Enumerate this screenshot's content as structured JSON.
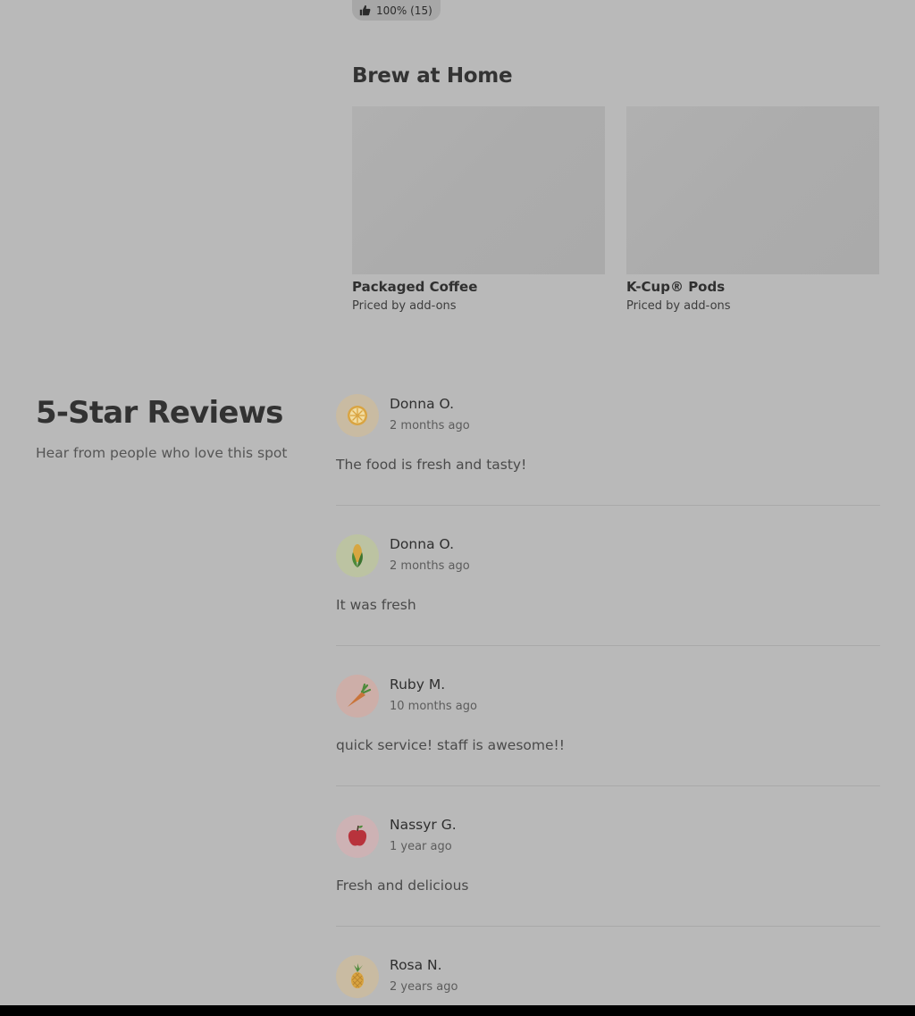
{
  "rating": {
    "icon": "thumbs-up-icon",
    "label": "100% (15)"
  },
  "brew_section": {
    "title": "Brew at Home",
    "items": [
      {
        "name": "Packaged Coffee",
        "price": "Priced by add-ons"
      },
      {
        "name": "K-Cup® Pods",
        "price": "Priced by add-ons"
      }
    ]
  },
  "reviews": {
    "title": "5-Star Reviews",
    "subtitle": "Hear from people who love this spot",
    "items": [
      {
        "author": "Donna O.",
        "time": "2 months ago",
        "text": "The food is fresh and tasty!",
        "avatar": "lemon-icon",
        "avatar_bg": "#c9bba2"
      },
      {
        "author": "Donna O.",
        "time": "2 months ago",
        "text": "It was fresh",
        "avatar": "corn-icon",
        "avatar_bg": "#bcc3a2"
      },
      {
        "author": "Ruby M.",
        "time": "10 months ago",
        "text": "quick service! staff is awesome!!",
        "avatar": "carrot-icon",
        "avatar_bg": "#cdaea8"
      },
      {
        "author": "Nassyr G.",
        "time": "1 year ago",
        "text": "Fresh and delicious",
        "avatar": "apple-icon",
        "avatar_bg": "#cdb2b4"
      },
      {
        "author": "Rosa N.",
        "time": "2 years ago",
        "text": "",
        "avatar": "pineapple-icon",
        "avatar_bg": "#c9bba2"
      }
    ]
  }
}
